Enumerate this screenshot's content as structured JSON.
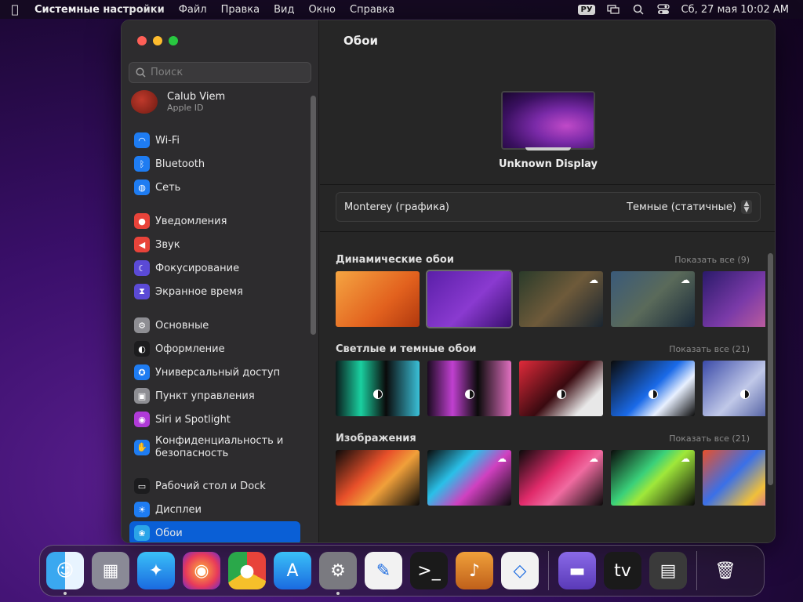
{
  "menubar": {
    "app": "Системные настройки",
    "items": [
      "Файл",
      "Правка",
      "Вид",
      "Окно",
      "Справка"
    ],
    "input_source": "РУ",
    "datetime": "Сб, 27 мая  10:02 AM"
  },
  "sidebar": {
    "search_placeholder": "Поиск",
    "account": {
      "name": "Calub Viem",
      "sub": "Apple ID"
    },
    "groups": [
      [
        {
          "label": "Wi-Fi",
          "icon": "wifi-icon",
          "color": "#1e7cf2"
        },
        {
          "label": "Bluetooth",
          "icon": "bluetooth-icon",
          "color": "#1e7cf2"
        },
        {
          "label": "Сеть",
          "icon": "globe-icon",
          "color": "#1e7cf2"
        }
      ],
      [
        {
          "label": "Уведомления",
          "icon": "notifications-icon",
          "color": "#e8433a"
        },
        {
          "label": "Звук",
          "icon": "sound-icon",
          "color": "#e8433a"
        },
        {
          "label": "Фокусирование",
          "icon": "moon-icon",
          "color": "#5b4ad6"
        },
        {
          "label": "Экранное время",
          "icon": "hourglass-icon",
          "color": "#5b4ad6"
        }
      ],
      [
        {
          "label": "Основные",
          "icon": "gear-icon",
          "color": "#8e8e93"
        },
        {
          "label": "Оформление",
          "icon": "appearance-icon",
          "color": "#1c1c1e"
        },
        {
          "label": "Универсальный доступ",
          "icon": "accessibility-icon",
          "color": "#1e7cf2"
        },
        {
          "label": "Пункт управления",
          "icon": "control-center-icon",
          "color": "#8e8e93"
        },
        {
          "label": "Siri и Spotlight",
          "icon": "siri-icon",
          "color": "#b03ad8"
        },
        {
          "label": "Конфиденциальность и безопасность",
          "icon": "hand-icon",
          "color": "#1e7cf2",
          "two": true
        }
      ],
      [
        {
          "label": "Рабочий стол и Dock",
          "icon": "dock-icon",
          "color": "#1c1c1e"
        },
        {
          "label": "Дисплеи",
          "icon": "displays-icon",
          "color": "#1e7cf2"
        },
        {
          "label": "Обои",
          "icon": "wallpaper-icon",
          "color": "#2aa4e8",
          "selected": true
        }
      ]
    ]
  },
  "main": {
    "title": "Обои",
    "display_name": "Unknown Display",
    "picker_left": "Monterey (графика)",
    "picker_right": "Темные (статичные)",
    "sections": [
      {
        "title": "Динамические обои",
        "show_all": "Показать все (9)",
        "thumbs": [
          {
            "bg": "linear-gradient(135deg,#f5a542,#e2611e 60%,#b0380e)"
          },
          {
            "bg": "linear-gradient(135deg,#5a1fa8,#8a3ad0 55%,#3a0f70)",
            "selected": true
          },
          {
            "bg": "linear-gradient(135deg,#2a3b2a,#6e5a3a 50%,#1a2530)",
            "cloud": true
          },
          {
            "bg": "linear-gradient(135deg,#3a5a7a,#5a6a5a 50%,#1a2a3a)",
            "cloud": true
          },
          {
            "bg": "linear-gradient(135deg,#2a1a6a,#7a3aa8 50%,#d66a9a)"
          }
        ]
      },
      {
        "title": "Светлые и темные обои",
        "show_all": "Показать все (21)",
        "thumbs": [
          {
            "bg": "linear-gradient(90deg,#0a1a1a,#1ad0a0 30%,#0a0a0a 60%,#3ac0d8)",
            "half": true
          },
          {
            "bg": "linear-gradient(90deg,#1a0a20,#c040d0 30%,#0a0a0a 60%,#e070c0)",
            "half": true
          },
          {
            "bg": "linear-gradient(135deg,#e02a3a,#3a0a10 50%,#e8e8e8 80%)",
            "half": true
          },
          {
            "bg": "linear-gradient(135deg,#0a0a0a,#1a6ae8 50%,#e8f0ff 70%,#0a0a0a)",
            "half": true
          },
          {
            "bg": "linear-gradient(135deg,#3a4aa8,#c0c8e8 50%,#2a3a88)",
            "half": true
          }
        ]
      },
      {
        "title": "Изображения",
        "show_all": "Показать все (21)",
        "thumbs": [
          {
            "bg": "linear-gradient(135deg,#0a0a0a,#e8502a 40%,#f0a03a 60%,#0a0a0a)"
          },
          {
            "bg": "linear-gradient(135deg,#0a0a0a,#2ac0e8 35%,#d040c0 60%,#0a0a0a)",
            "cloud": true
          },
          {
            "bg": "linear-gradient(135deg,#0a0a0a,#e02a6a 40%,#f06aa0 60%,#0a0a0a)",
            "cloud": true
          },
          {
            "bg": "linear-gradient(135deg,#0a0a0a,#3ad07a 40%,#a0e83a 55%,#0a0a0a)",
            "cloud": true
          },
          {
            "bg": "linear-gradient(135deg,#e8502a,#3a70e8 40%,#f0c03a 70%,#c03ad0)"
          }
        ]
      }
    ]
  },
  "dock": [
    {
      "name": "finder-icon",
      "bg": "linear-gradient(90deg,#3aa8f0 50%,#e8f4ff 50%)",
      "glyph": "☺",
      "running": true
    },
    {
      "name": "launchpad-icon",
      "bg": "#8a8a96",
      "glyph": "▦"
    },
    {
      "name": "safari-icon",
      "bg": "linear-gradient(#3ac0f8,#1a6ae0)",
      "glyph": "✦"
    },
    {
      "name": "firefox-icon",
      "bg": "radial-gradient(circle,#ffb23a,#e83a5a 60%,#6a2ad0)",
      "glyph": "◉"
    },
    {
      "name": "chrome-icon",
      "bg": "conic-gradient(#e8433a 0 33%,#f5c02a 0 66%,#2aa84a 0)",
      "glyph": "●"
    },
    {
      "name": "app-store-icon",
      "bg": "linear-gradient(#3ac0f8,#1a6ae0)",
      "glyph": "A"
    },
    {
      "name": "system-settings-icon",
      "bg": "#7a7a80",
      "glyph": "⚙",
      "running": true
    },
    {
      "name": "textedit-icon",
      "bg": "#f2f2f2",
      "glyph": "✎"
    },
    {
      "name": "terminal-icon",
      "bg": "#1a1a1a",
      "glyph": ">_"
    },
    {
      "name": "garageband-icon",
      "bg": "linear-gradient(#f0a03a,#c0601a)",
      "glyph": "♪"
    },
    {
      "name": "vscode-icon",
      "bg": "#f2f2f2",
      "glyph": "◇"
    },
    {
      "name": "sep"
    },
    {
      "name": "disk-utility-icon",
      "bg": "linear-gradient(#8a6ae8,#5a3ab8)",
      "glyph": "▬"
    },
    {
      "name": "apple-tv-icon",
      "bg": "#1a1a1a",
      "glyph": "tv"
    },
    {
      "name": "calculator-icon",
      "bg": "#3a3a3a",
      "glyph": "▤"
    },
    {
      "name": "sep"
    },
    {
      "name": "trash-icon",
      "bg": "transparent",
      "glyph": "🗑"
    }
  ]
}
